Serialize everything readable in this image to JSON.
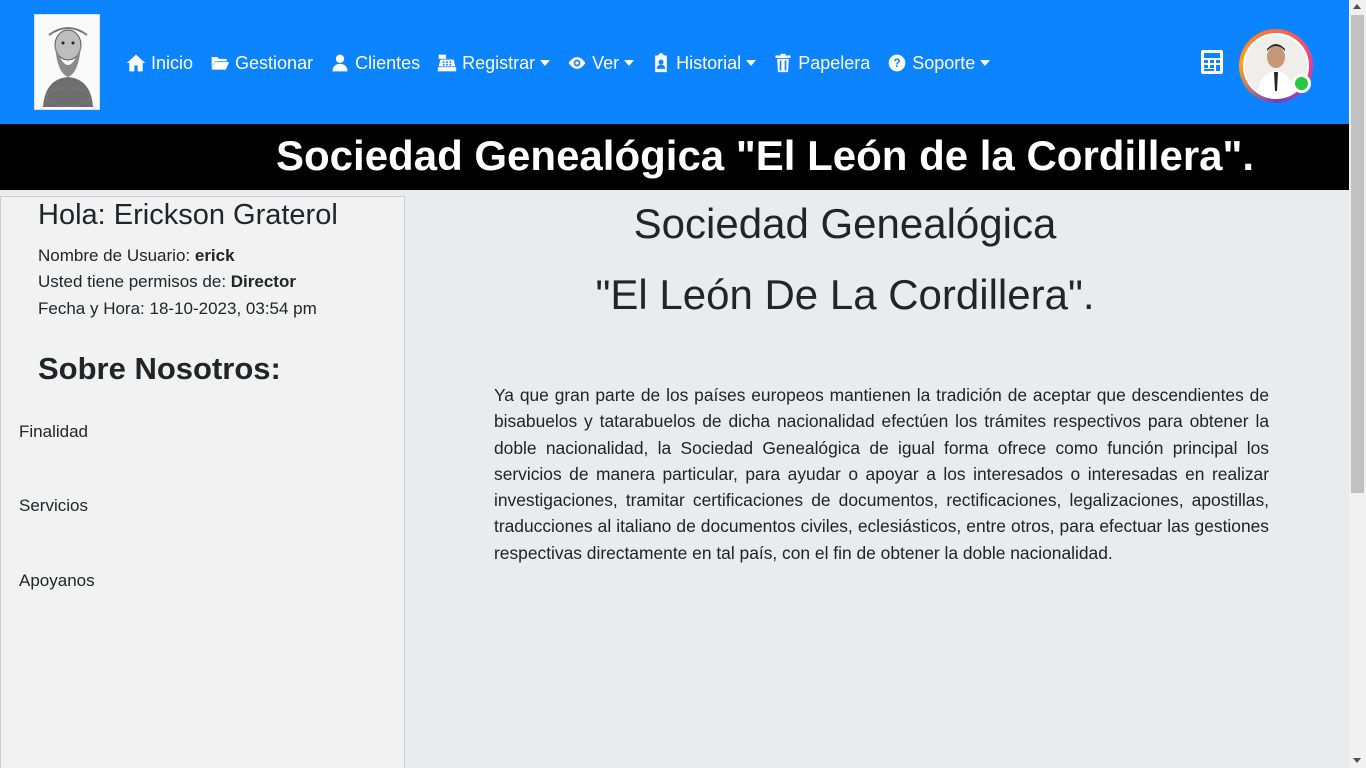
{
  "navbar": {
    "bg_color": "#0d84ff",
    "logo_icon": "portrait-logo",
    "items": [
      {
        "label": "Inicio",
        "icon": "home-icon",
        "dropdown": false
      },
      {
        "label": "Gestionar",
        "icon": "folder-open-icon",
        "dropdown": false
      },
      {
        "label": "Clientes",
        "icon": "user-icon",
        "dropdown": false
      },
      {
        "label": "Registrar",
        "icon": "cash-register-icon",
        "dropdown": true
      },
      {
        "label": "Ver",
        "icon": "eye-icon",
        "dropdown": true
      },
      {
        "label": "Historial",
        "icon": "clipboard-user-icon",
        "dropdown": true
      },
      {
        "label": "Papelera",
        "icon": "trash-icon",
        "dropdown": false
      },
      {
        "label": "Soporte",
        "icon": "question-circle-icon",
        "dropdown": true
      }
    ],
    "calculator_icon": "calculator-icon",
    "status_color": "#28c741"
  },
  "banner": {
    "text": "Sociedad Genealógica \"El León de la Cordillera\"."
  },
  "sidebar": {
    "greeting": "Hola: Erickson Graterol",
    "username_label": "Nombre de Usuario:",
    "username": "erick",
    "permissions_label": "Usted tiene permisos de:",
    "permissions": "Director",
    "datetime_label": "Fecha y Hora:",
    "datetime": "18-10-2023, 03:54 pm",
    "about_title": "Sobre Nosotros:",
    "links": [
      "Finalidad",
      "Servicios",
      "Apoyanos"
    ]
  },
  "main": {
    "title_line1": "Sociedad Genealógica",
    "title_line2": "\"El León De La Cordillera\".",
    "paragraph": "Ya que gran parte de los países europeos mantienen la tradición de aceptar que descendientes de bisabuelos y tatarabuelos de dicha nacionalidad efectúen los trámites respectivos para obtener la doble nacionalidad, la Sociedad Genealógica de igual forma ofrece como función principal los servicios de manera particular, para ayudar o apoyar a los interesados o interesadas en realizar investigaciones, tramitar certificaciones de documentos, rectificaciones, legalizaciones, apostillas, traducciones al italiano de documentos civiles, eclesiásticos, entre otros, para efectuar las gestiones respectivas directamente en tal país, con el fin de obtener la doble nacionalidad."
  }
}
